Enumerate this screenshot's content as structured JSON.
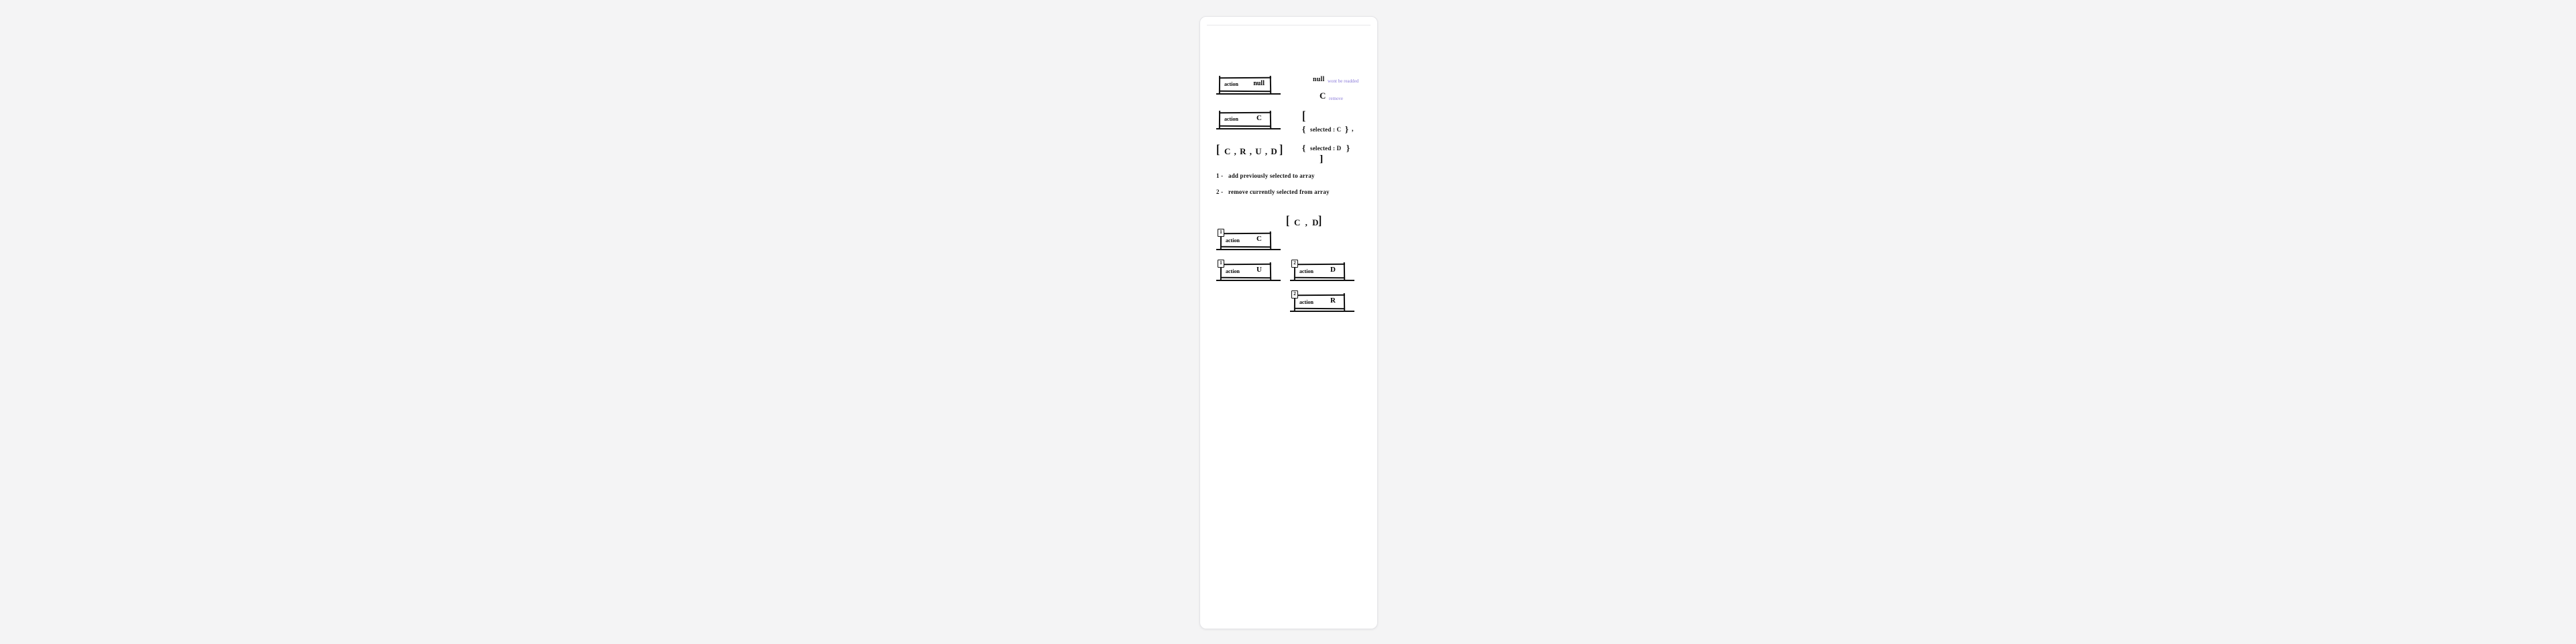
{
  "box1": {
    "label": "action",
    "value": "null"
  },
  "box2": {
    "label": "action",
    "value": "C"
  },
  "array_full": "C ,  R ,  U ,  D",
  "note_null": {
    "word": "null",
    "annot": "wont be readded"
  },
  "note_c": {
    "word": "C",
    "annot": "remove"
  },
  "sel1": "selected :  C",
  "sel2": "selected :  D",
  "step1_n": "1 -",
  "step1": "add  previously  selected  to  array",
  "step2_n": "2 -",
  "step2": "remove  currently  selected  from  array",
  "array_small": "C ,  D",
  "box3": {
    "label": "action",
    "value": "C",
    "pin": "1"
  },
  "box4": {
    "label": "action",
    "value": "U",
    "pin": "1"
  },
  "box5": {
    "label": "action",
    "value": "D",
    "pin": "2"
  },
  "box6": {
    "label": "action",
    "value": "R",
    "pin": "2"
  }
}
